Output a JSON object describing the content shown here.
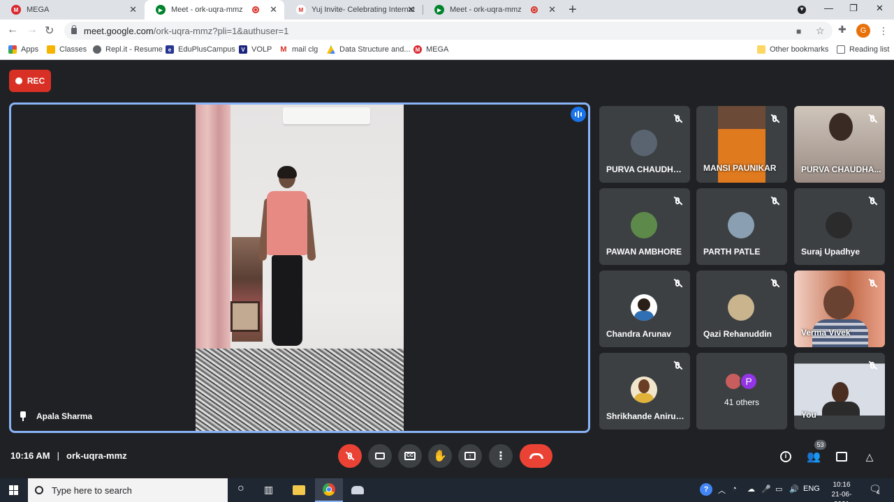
{
  "browser": {
    "tabs": [
      {
        "title": "MEGA",
        "active": false,
        "recording": false
      },
      {
        "title": "Meet - ork-uqra-mmz",
        "active": true,
        "recording": true
      },
      {
        "title": "Yuj Invite- Celebrating Internatio",
        "active": false,
        "recording": false
      },
      {
        "title": "Meet - ork-uqra-mmz",
        "active": false,
        "recording": true
      }
    ],
    "url_host": "meet.google.com",
    "url_path": "/ork-uqra-mmz?pli=1&authuser=1",
    "profile_initial": "G",
    "bookmarks": [
      "Apps",
      "Classes",
      "Repl.it - Resume",
      "EduPlusCampus",
      "VOLP",
      "mail clg",
      "Data Structure and...",
      "MEGA"
    ],
    "other_bookmarks": "Other bookmarks",
    "reading_list": "Reading list"
  },
  "meet": {
    "rec_label": "REC",
    "main_speaker": "Apala Sharma",
    "participants": [
      {
        "name": "PURVA CHAUDHARI",
        "muted": true,
        "video": false,
        "avatar_color": "#5a6470"
      },
      {
        "name": "MANSI PAUNIKAR",
        "muted": true,
        "video": true,
        "avatar_color": "#e07a1f"
      },
      {
        "name": "PURVA CHAUDHA...",
        "muted": true,
        "video": true,
        "avatar_color": "#b7a9a0"
      },
      {
        "name": "PAWAN AMBHORE",
        "muted": true,
        "video": false,
        "avatar_color": "#5d8a4a"
      },
      {
        "name": "PARTH PATLE",
        "muted": true,
        "video": false,
        "avatar_color": "#8aa0b2"
      },
      {
        "name": "Suraj Upadhye",
        "muted": true,
        "video": false,
        "avatar_color": "#2b2b2b"
      },
      {
        "name": "Chandra Arunav",
        "muted": true,
        "video": false,
        "avatar_color": "#2f6fb3"
      },
      {
        "name": "Qazi Rehanuddin",
        "muted": true,
        "video": false,
        "avatar_color": "#c9b48e"
      },
      {
        "name": "Verma Vivek",
        "muted": true,
        "video": true,
        "avatar_color": "#c26b4a"
      },
      {
        "name": "Shrikhande Anirud...",
        "muted": true,
        "video": false,
        "avatar_color": "#e0b23a"
      },
      {
        "name": "41 others",
        "muted": false,
        "video": false,
        "avatar_color": "#9334e6",
        "badge_letter": "P"
      },
      {
        "name": "You",
        "muted": true,
        "video": true,
        "avatar_color": "#d8dde6"
      }
    ],
    "time": "10:16 AM",
    "meeting_code": "ork-uqra-mmz",
    "participant_count": "53"
  },
  "taskbar": {
    "search_placeholder": "Type here to search",
    "language": "ENG",
    "clock_time": "10:16",
    "clock_date": "21-06-2021",
    "notification_count": "4"
  }
}
